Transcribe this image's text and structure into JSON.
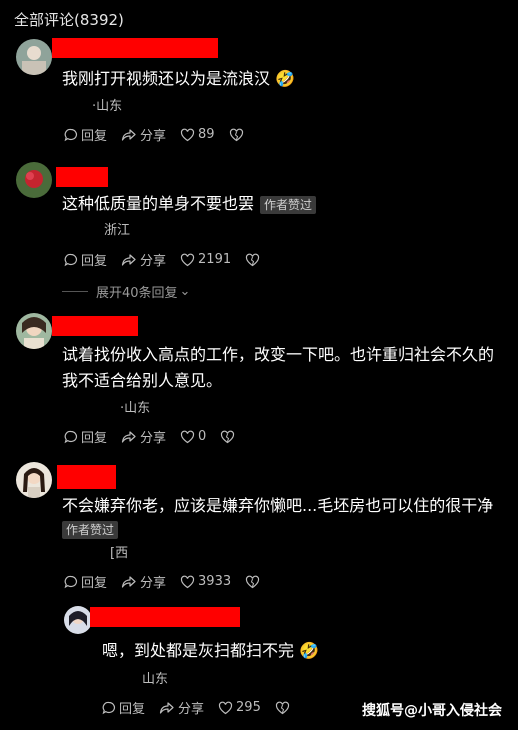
{
  "header": {
    "title": "全部评论(8392)"
  },
  "labels": {
    "reply": "回复",
    "share": "分享",
    "author_liked": "作者赞过"
  },
  "comments": [
    {
      "text": "我刚打开视频还以为是流浪汉",
      "location": "·山东",
      "likes": "89"
    },
    {
      "text": "这种低质量的单身不要也罢",
      "location": "浙江",
      "likes": "2191"
    },
    {
      "text_line1": "试着找份收入高点的工作，改变一下吧。也许重归社会不久的",
      "text_line2": "我不适合给别人意见。",
      "location": "·山东",
      "likes": "0"
    },
    {
      "text": "不会嫌弃你老，应该是嫌弃你懒吧...毛坯房也可以住的很干净",
      "location": "[西",
      "likes": "3933"
    },
    {
      "text": "嗯，到处都是灰扫都扫不完",
      "location": "山东",
      "likes": "295"
    }
  ],
  "expand_replies": "展开40条回复",
  "watermark": "搜狐号@小哥入侵社会",
  "colors": {
    "background": "#000000",
    "redaction": "#ff0000",
    "muted": "#bdbdbd"
  }
}
